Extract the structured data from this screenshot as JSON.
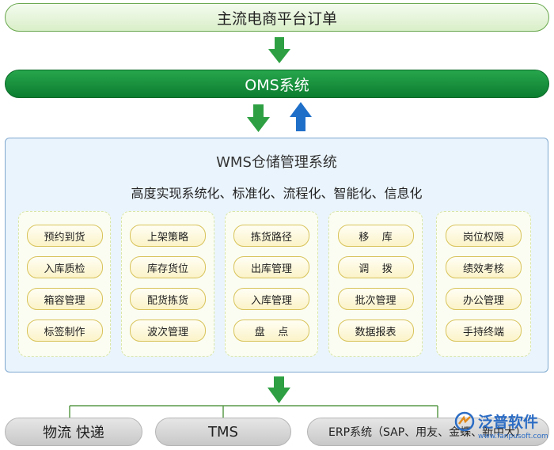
{
  "top_bar": {
    "label": "主流电商平台订单"
  },
  "oms_bar": {
    "label": "OMS系统"
  },
  "wms": {
    "title": "WMS仓储管理系统",
    "subtitle": "高度实现系统化、标准化、流程化、智能化、信息化",
    "groups": [
      {
        "items": [
          "预约到货",
          "入库质检",
          "箱容管理",
          "标签制作"
        ]
      },
      {
        "items": [
          "上架策略",
          "库存货位",
          "配货拣货",
          "波次管理"
        ]
      },
      {
        "items": [
          "拣货路径",
          "出库管理",
          "入库管理",
          "盘    点"
        ]
      },
      {
        "items": [
          "移    库",
          "调    拨",
          "批次管理",
          "数据报表"
        ]
      },
      {
        "items": [
          "岗位权限",
          "绩效考核",
          "办公管理",
          "手持终端"
        ]
      }
    ]
  },
  "bottom": {
    "wuliu": "物流 快递",
    "tms": "TMS",
    "erp": "ERP系统（SAP、用友、金蝶、新中大）"
  },
  "watermark": {
    "name": "泛普软件",
    "url": "www.fanpusoft.com"
  },
  "colors": {
    "arrow_green": "#2ea043",
    "arrow_blue": "#1f6fc9",
    "oms_green": "#138a37",
    "panel_blue": "#eaf4fc"
  },
  "icons": {
    "arrow_down": "arrow-down-icon",
    "arrow_up": "arrow-up-icon",
    "logo": "fanpu-logo-icon"
  }
}
